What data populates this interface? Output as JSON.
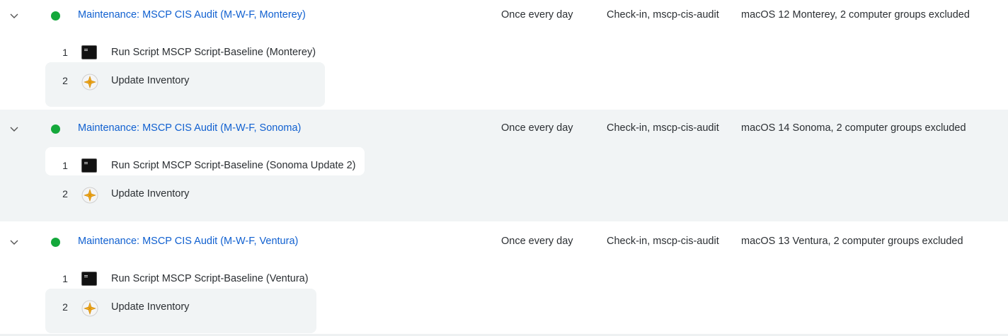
{
  "policies": [
    {
      "status": "enabled",
      "name": "Maintenance: MSCP CIS Audit (M-W-F, Monterey)",
      "frequency": "Once every day",
      "trigger": "Check-in, mscp-cis-audit",
      "scope": "macOS 12 Monterey, 2 computer groups excluded",
      "steps": [
        {
          "number": "1",
          "icon": "terminal-icon",
          "label": "Run Script MSCP Script-Baseline (Monterey)"
        },
        {
          "number": "2",
          "icon": "inventory-icon",
          "label": "Update Inventory"
        }
      ]
    },
    {
      "status": "enabled",
      "name": "Maintenance: MSCP CIS Audit (M-W-F, Sonoma)",
      "frequency": "Once every day",
      "trigger": "Check-in, mscp-cis-audit",
      "scope": "macOS 14 Sonoma, 2 computer groups excluded",
      "steps": [
        {
          "number": "1",
          "icon": "terminal-icon",
          "label": "Run Script MSCP Script-Baseline (Sonoma Update 2)"
        },
        {
          "number": "2",
          "icon": "inventory-icon",
          "label": "Update Inventory"
        }
      ]
    },
    {
      "status": "enabled",
      "name": "Maintenance: MSCP CIS Audit (M-W-F, Ventura)",
      "frequency": "Once every day",
      "trigger": "Check-in, mscp-cis-audit",
      "scope": "macOS 13 Ventura, 2 computer groups excluded",
      "steps": [
        {
          "number": "1",
          "icon": "terminal-icon",
          "label": "Run Script MSCP Script-Baseline (Ventura)"
        },
        {
          "number": "2",
          "icon": "inventory-icon",
          "label": "Update Inventory"
        }
      ]
    }
  ],
  "colors": {
    "status_enabled": "#14a83b",
    "link": "#1060d0",
    "row_shade": "#f1f4f5"
  }
}
